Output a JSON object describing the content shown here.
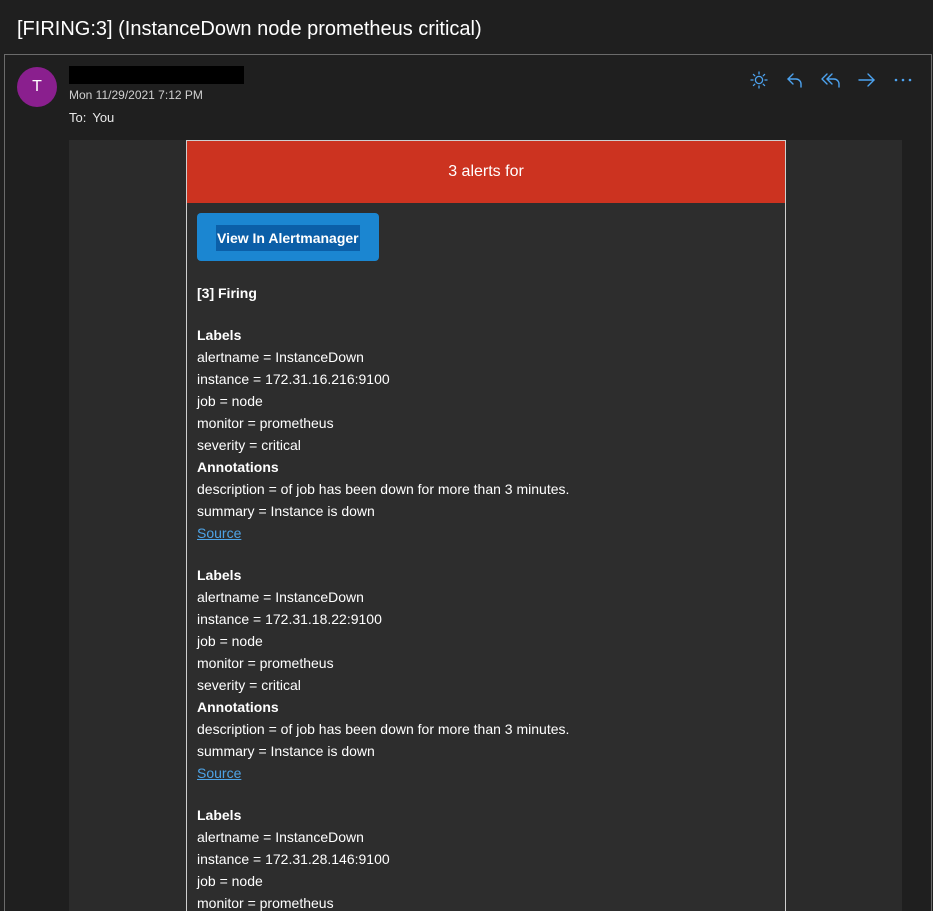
{
  "subject": "[FIRING:3] (InstanceDown node prometheus critical)",
  "header": {
    "avatar_initial": "T",
    "date": "Mon 11/29/2021 7:12 PM",
    "to_label": "To:",
    "to_value": "You"
  },
  "toolbar": {
    "actions": [
      "sun-icon",
      "reply-icon",
      "reply-all-icon",
      "forward-icon",
      "more-icon"
    ]
  },
  "email": {
    "banner": "3 alerts for",
    "button_label": "View In Alertmanager",
    "firing_heading": "[3] Firing",
    "labels_heading": "Labels",
    "annotations_heading": "Annotations",
    "source_label": "Source",
    "alerts": [
      {
        "alertname": "alertname = InstanceDown",
        "instance": "instance = 172.31.16.216:9100",
        "job": "job = node",
        "monitor": "monitor = prometheus",
        "severity": "severity = critical",
        "description": "description = of job has been down for more than 3 minutes.",
        "summary": "summary = Instance is down"
      },
      {
        "alertname": "alertname = InstanceDown",
        "instance": "instance = 172.31.18.22:9100",
        "job": "job = node",
        "monitor": "monitor = prometheus",
        "severity": "severity = critical",
        "description": "description = of job has been down for more than 3 minutes.",
        "summary": "summary = Instance is down"
      },
      {
        "alertname": "alertname = InstanceDown",
        "instance": "instance = 172.31.28.146:9100",
        "job": "job = node",
        "monitor": "monitor = prometheus"
      }
    ]
  },
  "colors": {
    "banner": "#cc3320",
    "button": "#1b86d1",
    "link": "#4ea3e6",
    "avatar": "#8a1f8e",
    "toolbar_icon": "#4da3f0"
  }
}
